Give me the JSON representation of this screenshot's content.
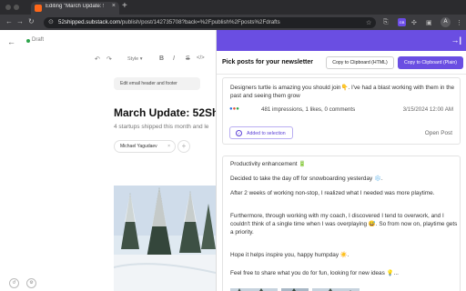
{
  "browser": {
    "tab_title": "Editing \"March Update: 52Sh",
    "tab_close": "×",
    "new_tab": "+",
    "url_host": "52shipped.substack.com",
    "url_path": "/publish/post/142735708?back=%2Fpublish%2Fposts%2Fdrafts",
    "ext_badge": "GB",
    "profile": "A"
  },
  "editor": {
    "back": "←",
    "status": "Draft",
    "toolbar": {
      "style": "Style ▾",
      "bold": "B",
      "italic": "I",
      "strike": "S",
      "code": "</>"
    },
    "edit_header_button": "Edit email header and footer",
    "post_title": "March Update: 52Shi",
    "post_subtitle": "4 startups shipped this month and le",
    "author": "Michael Yagudaev",
    "author_remove": "×",
    "add_author": "+"
  },
  "panel": {
    "title": "Pick posts for your newsletter",
    "btn_copy_html": "Copy to Clipboard (HTML)",
    "btn_copy_plain": "Copy to Clipboard (Plain)",
    "card1": {
      "text": "Designers turtle is amazing you should join👇. I've had a blast working with them in the past and seeing them grow",
      "stats": "481 impressions, 1 likes, 0 comments",
      "date": "3/15/2024 12:00 AM",
      "added": "Added to selection",
      "open": "Open Post"
    },
    "card2": {
      "p1": "Productivity enhancement 🔋",
      "p2": "Decided to take the day off for snowboarding yesterday ❄️.",
      "p3": "After 2 weeks of working non-stop, I realized what I needed was more playtime.",
      "p4": "Furthermore, through working with my coach, I discovered I tend to overwork, and I couldn't think of a single time when I was overplaying 😅. So from now on, playtime gets a priority.",
      "p5": "Hope it helps inspire you, happy humpday ☀️.",
      "p6": "Feel free to share what you do for fun, looking for new ideas 💡..."
    }
  },
  "colors": {
    "accent": "#6a4ee2",
    "chrome": "#2b2b2e",
    "draft": "#2ca44a"
  }
}
